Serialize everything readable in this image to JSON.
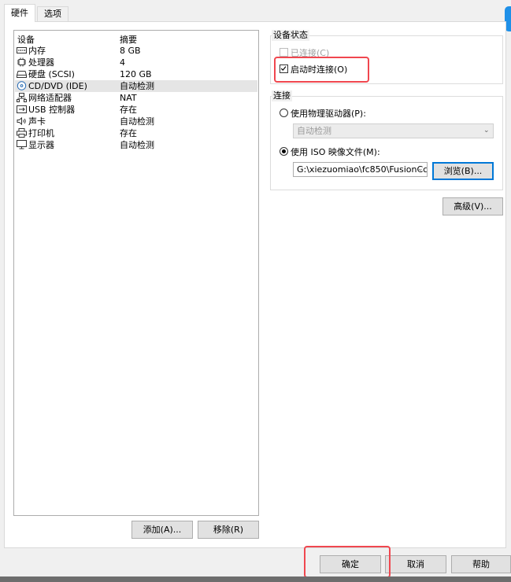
{
  "tabs": [
    {
      "label": "硬件",
      "active": true
    },
    {
      "label": "选项",
      "active": false
    }
  ],
  "device_list": {
    "header_device": "设备",
    "header_summary": "摘要",
    "items": [
      {
        "name": "内存",
        "summary": "8 GB",
        "icon": "memory-icon"
      },
      {
        "name": "处理器",
        "summary": "4",
        "icon": "cpu-icon"
      },
      {
        "name": "硬盘 (SCSI)",
        "summary": "120 GB",
        "icon": "harddisk-icon"
      },
      {
        "name": "CD/DVD (IDE)",
        "summary": "自动检测",
        "icon": "cd-dvd-icon",
        "selected": true
      },
      {
        "name": "网络适配器",
        "summary": "NAT",
        "icon": "network-adapter-icon"
      },
      {
        "name": "USB 控制器",
        "summary": "存在",
        "icon": "usb-icon"
      },
      {
        "name": "声卡",
        "summary": "自动检测",
        "icon": "sound-card-icon"
      },
      {
        "name": "打印机",
        "summary": "存在",
        "icon": "printer-icon"
      },
      {
        "name": "显示器",
        "summary": "自动检测",
        "icon": "display-icon"
      }
    ],
    "add_button": "添加(A)...",
    "remove_button": "移除(R)"
  },
  "device_status": {
    "title": "设备状态",
    "connected": {
      "label": "已连接(C)",
      "checked": false,
      "disabled": true
    },
    "connect_at_power_on": {
      "label": "启动时连接(O)",
      "checked": true
    }
  },
  "connection": {
    "title": "连接",
    "physical_drive": {
      "label": "使用物理驱动器(P):",
      "selected": false
    },
    "physical_drive_value": "自动检测",
    "iso_image": {
      "label": "使用 ISO 映像文件(M):",
      "selected": true
    },
    "iso_path": "G:\\xiezuomiao\\fc850\\FusionCc",
    "browse_button": "浏览(B)..."
  },
  "advanced_button": "高级(V)...",
  "footer": {
    "ok": "确定",
    "cancel": "取消",
    "help": "帮助"
  },
  "colors": {
    "highlight": "#f0474f",
    "accent": "#1e90e8"
  }
}
